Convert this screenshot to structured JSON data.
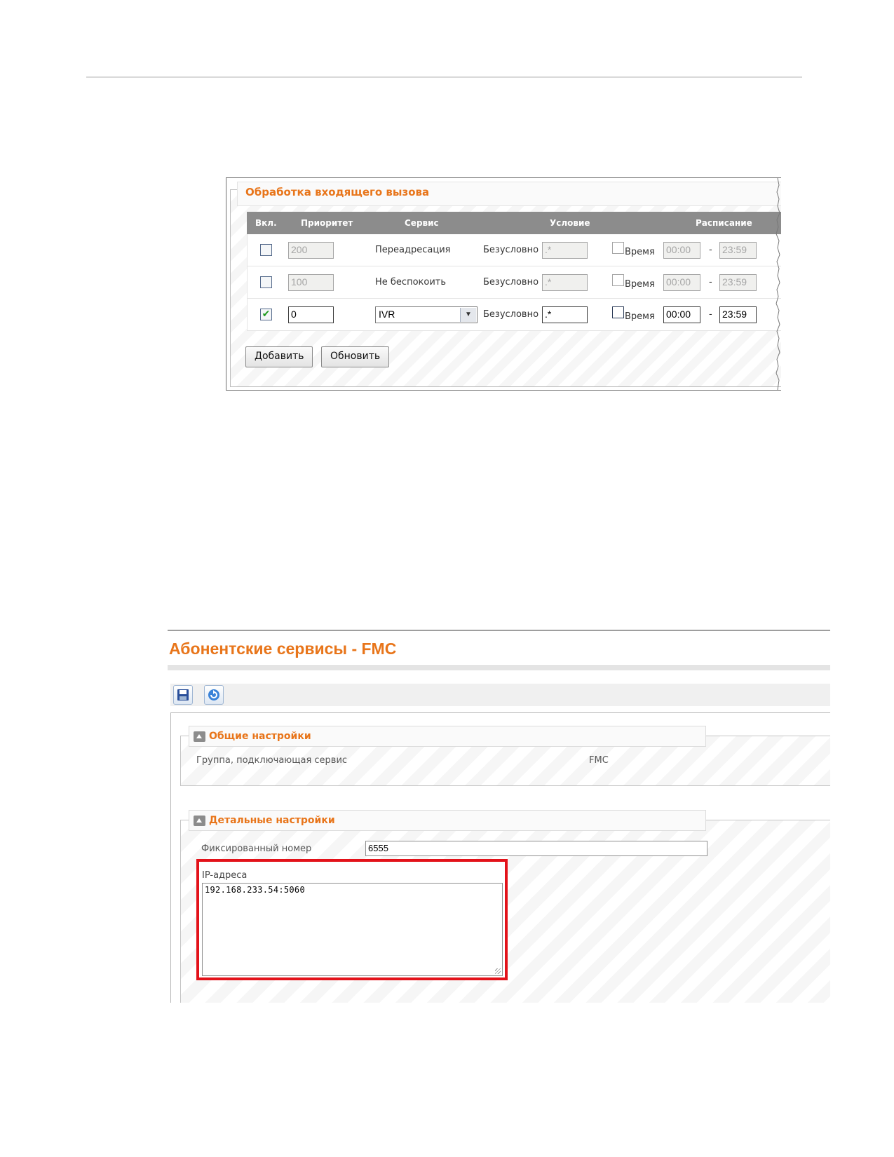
{
  "panel_incoming": {
    "title": "Обработка входящего вызова",
    "columns": [
      "Вкл.",
      "Приоритет",
      "Сервис",
      "Условие",
      "Расписание"
    ],
    "rows": [
      {
        "enabled": false,
        "priority": "200",
        "service": "Переадресация",
        "condition": "Безусловно",
        "condition_value": ".*",
        "time_label": "Время",
        "time_from": "00:00",
        "dash": "-",
        "time_to": "23:59"
      },
      {
        "enabled": false,
        "priority": "100",
        "service": "Не беспокоить",
        "condition": "Безусловно",
        "condition_value": ".*",
        "time_label": "Время",
        "time_from": "00:00",
        "dash": "-",
        "time_to": "23:59"
      },
      {
        "enabled": true,
        "priority": "0",
        "service": "IVR",
        "condition": "Безусловно",
        "condition_value": ".*",
        "time_label": "Время",
        "time_from": "00:00",
        "dash": "-",
        "time_to": "23:59"
      }
    ],
    "buttons": {
      "add": "Добавить",
      "refresh": "Обновить"
    },
    "colors": {
      "title": "#e8751a",
      "header_bg": "#8c8c8c",
      "check": "#1e9a1e"
    }
  },
  "panel_fmc": {
    "title": "Абонентские сервисы - FMC",
    "toolbar": [
      {
        "icon": "save-icon"
      },
      {
        "icon": "refresh-icon"
      }
    ],
    "general": {
      "legend": "Общие настройки",
      "group_label": "Группа, подключающая сервис",
      "group_value": "FMC"
    },
    "details": {
      "legend": "Детальные настройки",
      "fixed_number_label": "Фиксированный номер",
      "fixed_number_value": "6555",
      "ip_label": "IP-адреса",
      "ip_value": "192.168.233.54:5060"
    },
    "colors": {
      "title": "#e8751a",
      "highlight": "#e3121a"
    }
  }
}
